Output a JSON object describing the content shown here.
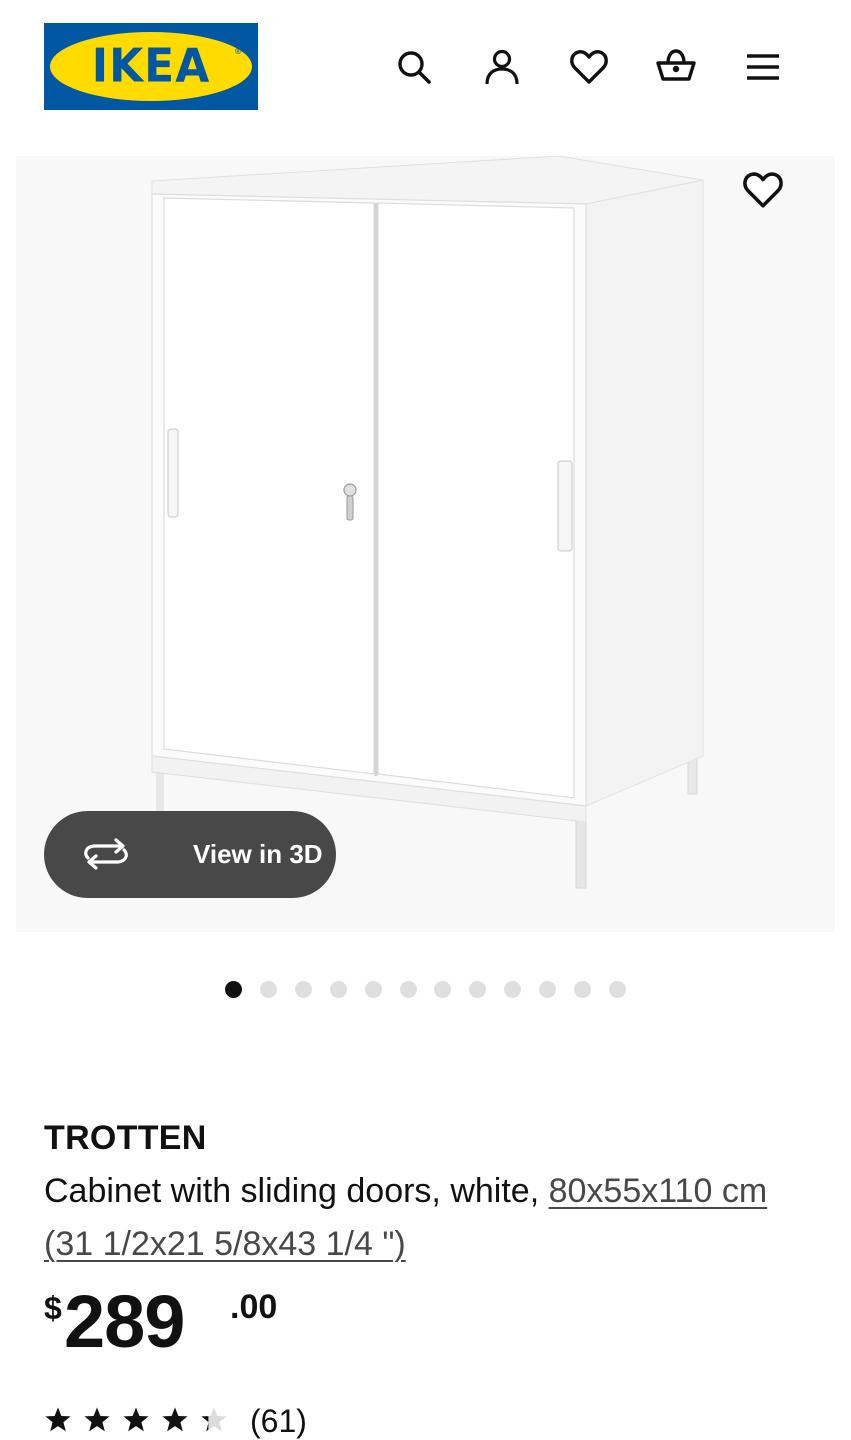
{
  "header": {
    "logo_text": "IKEA",
    "logo_reg": "®",
    "icons": [
      "search-icon",
      "account-icon",
      "favourites-icon",
      "cart-icon",
      "menu-icon"
    ]
  },
  "gallery": {
    "view3d_label": "View in 3D",
    "favourite_icon": "heart-outline-icon",
    "image_count": 12,
    "active_index": 0
  },
  "product": {
    "name": "TROTTEN",
    "description": "Cabinet with sliding doors, white, ",
    "dimensions": "80x55x110 cm (31 1/2x21 5/8x43 1/4 \")",
    "price": {
      "currency": "$",
      "integer": "289",
      "decimal": ".00"
    },
    "rating": {
      "value": 4.3,
      "max": 5,
      "count_label": "(61)"
    }
  },
  "colors": {
    "ikea_blue": "#0058A3",
    "ikea_yellow": "#FFDB00",
    "pill_bg": "#484848",
    "dot_active": "#111111",
    "dot_inactive": "#dfdfdf"
  }
}
